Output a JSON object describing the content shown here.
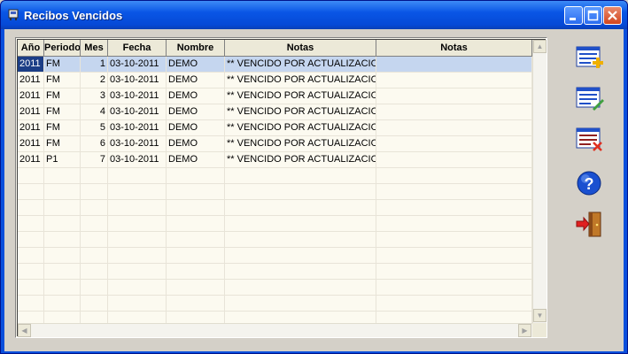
{
  "window": {
    "title": "Recibos Vencidos"
  },
  "table": {
    "columns": [
      "Año",
      "Periodo",
      "Mes",
      "Fecha",
      "Nombre",
      "Notas",
      "Notas"
    ],
    "rows": [
      [
        "2011",
        "FM",
        "1",
        "03-10-2011",
        "DEMO",
        "** VENCIDO POR ACTUALIZACION",
        ""
      ],
      [
        "2011",
        "FM",
        "2",
        "03-10-2011",
        "DEMO",
        "** VENCIDO POR ACTUALIZACION",
        ""
      ],
      [
        "2011",
        "FM",
        "3",
        "03-10-2011",
        "DEMO",
        "** VENCIDO POR ACTUALIZACION",
        ""
      ],
      [
        "2011",
        "FM",
        "4",
        "03-10-2011",
        "DEMO",
        "** VENCIDO POR ACTUALIZACION",
        ""
      ],
      [
        "2011",
        "FM",
        "5",
        "03-10-2011",
        "DEMO",
        "** VENCIDO POR ACTUALIZACION",
        ""
      ],
      [
        "2011",
        "FM",
        "6",
        "03-10-2011",
        "DEMO",
        "** VENCIDO POR ACTUALIZACION",
        ""
      ],
      [
        "2011",
        "P1",
        "7",
        "03-10-2011",
        "DEMO",
        "** VENCIDO POR ACTUALIZACION",
        ""
      ]
    ],
    "selected_row": 0
  },
  "toolbar": {
    "buttons": [
      {
        "name": "add-record-button",
        "icon": "add-list-icon"
      },
      {
        "name": "edit-record-button",
        "icon": "edit-list-icon"
      },
      {
        "name": "delete-record-button",
        "icon": "delete-list-icon"
      },
      {
        "name": "help-button",
        "icon": "help-icon"
      },
      {
        "name": "exit-button",
        "icon": "exit-door-icon"
      }
    ]
  },
  "colors": {
    "title_bar": "#0a56e6",
    "selection": "#c5d6ef",
    "selected_first_cell": "#1c3e86",
    "grid_background": "#fcfaf0"
  }
}
